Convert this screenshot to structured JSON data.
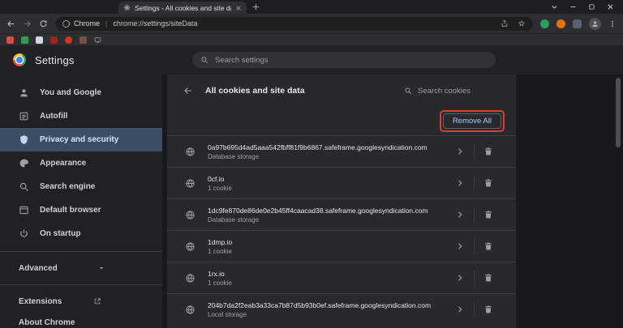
{
  "window": {
    "tab_title": "Settings - All cookies and site da"
  },
  "toolbar": {
    "url_prefix": "Chrome",
    "url_separator": "|",
    "url": "chrome://settings/siteData",
    "extensions": [
      {
        "name": "extension-icon-1",
        "color": "#28a05a",
        "shape": "circle"
      },
      {
        "name": "extension-icon-2",
        "color": "#e8710a",
        "shape": "circle"
      },
      {
        "name": "extension-icon-3",
        "color": "#5b6073",
        "shape": "square"
      }
    ]
  },
  "bookmarks": [
    {
      "name": "bookmark-favicon-1",
      "color": "#e2493f",
      "shape": "square"
    },
    {
      "name": "bookmark-favicon-2",
      "color": "#2e9e4f",
      "shape": "square"
    },
    {
      "name": "bookmark-favicon-3",
      "color": "#cfd9e6",
      "shape": "square"
    },
    {
      "name": "bookmark-favicon-4",
      "color": "#a02020",
      "shape": "square"
    },
    {
      "name": "bookmark-favicon-5",
      "color": "#d93025",
      "shape": "circle"
    },
    {
      "name": "bookmark-favicon-6",
      "color": "#6f5443",
      "shape": "square"
    },
    {
      "name": "bookmark-favicon-7",
      "color": "#9aa0a6",
      "shape": "monitor"
    }
  ],
  "settings_header": {
    "title": "Settings",
    "search_placeholder": "Search settings"
  },
  "sidebar": {
    "items": [
      {
        "label": "You and Google",
        "icon": "person",
        "selected": false
      },
      {
        "label": "Autofill",
        "icon": "autofill",
        "selected": false
      },
      {
        "label": "Privacy and security",
        "icon": "shield",
        "selected": true
      },
      {
        "label": "Appearance",
        "icon": "palette",
        "selected": false
      },
      {
        "label": "Search engine",
        "icon": "search",
        "selected": false
      },
      {
        "label": "Default browser",
        "icon": "browser",
        "selected": false
      },
      {
        "label": "On startup",
        "icon": "power",
        "selected": false
      }
    ],
    "advanced_label": "Advanced",
    "extensions_label": "Extensions",
    "about_label": "About Chrome"
  },
  "page": {
    "title": "All cookies and site data",
    "search_placeholder": "Search cookies",
    "remove_all_label": "Remove All",
    "rows": [
      {
        "site": "0a97b695d4ad5aaa542fbff81f9b6867.safeframe.googlesyndication.com",
        "detail": "Database storage"
      },
      {
        "site": "0cf.io",
        "detail": "1 cookie"
      },
      {
        "site": "1dc9fe870de86de0e2b45ff4caacad38.safeframe.googlesyndication.com",
        "detail": "Database storage"
      },
      {
        "site": "1dmp.io",
        "detail": "1 cookie"
      },
      {
        "site": "1rx.io",
        "detail": "1 cookie"
      },
      {
        "site": "204b7da2f2eab3a33ca7b87d5b93b0ef.safeframe.googlesyndication.com",
        "detail": "Local storage"
      }
    ]
  },
  "colors": {
    "annotation_red": "#e03a32",
    "accent_blue": "#aecbfa",
    "selected_item_bg": "#3c4e63"
  }
}
